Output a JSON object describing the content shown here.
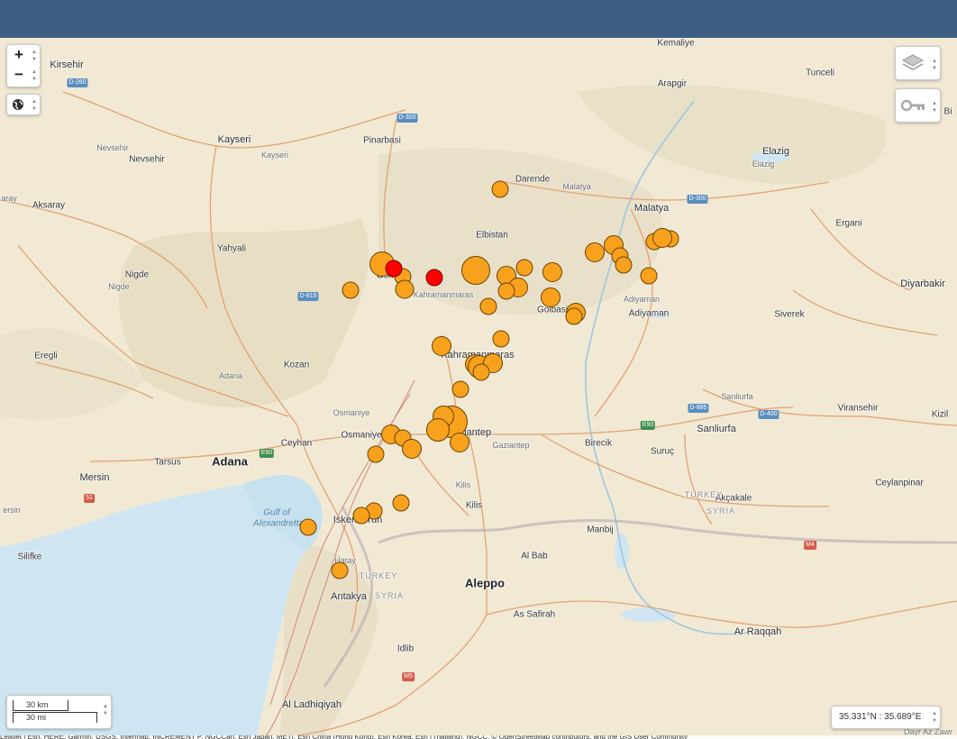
{
  "map": {
    "zoom": {
      "in_label": "+",
      "out_label": "−"
    },
    "coords": "35.331°N : 35.689°E",
    "scale": {
      "km": "30 km",
      "mi": "30 mi"
    },
    "attribution": "Leaflet | Esri, HERE, Garmin, USGS, Intermap, INCREMENT P, NGCCan, Esri Japan, METI, Esri China (Hong Kong), Esri Korea, Esri (Thailand), NGCC, © OpenStreetMap contributors, and the GIS User Community",
    "colors": {
      "quake": "#f7a11d",
      "recent_quake": "#ff0000",
      "header": "#3e5d82",
      "sea": "#cfe6f2"
    },
    "icons": [
      "layers-icon",
      "key-icon",
      "globe-icon"
    ],
    "labels": {
      "kirsehir": "Kirsehir",
      "kayseri": "Kayseri",
      "kayseri_small": "Kayseri",
      "nevsehir": "Nevsehir",
      "nevsehir_small": "Nevsehir",
      "aksaray": "Aksaray",
      "aray": "aray",
      "nigde": "Nigde",
      "nigde_small": "Nigde",
      "eregli": "Eregli",
      "yahyali": "Yahyali",
      "pinarbasi": "Pinarbasi",
      "kemaliye": "Kemaliye",
      "arapgir": "Arapgir",
      "tunceli": "Tunceli",
      "elazig": "Elazig",
      "elazig_small": "Elazig",
      "bi": "Bi",
      "darende": "Darende",
      "malatya_small": "Malatya",
      "malatya": "Malatya",
      "ergani": "Ergani",
      "elbistan": "Elbistan",
      "goksun": "Gök",
      "kahramanmaras_small": "Kahramanmaras",
      "golbasi": "Golbasi",
      "adiyaman_small": "Adiyaman",
      "adiyaman": "Adiyaman",
      "diyarbakir": "Diyarbakir",
      "siverek": "Siverek",
      "kahramanmaras": "Kahramanmaras",
      "kozan": "Kozan",
      "adana_small": "Adana",
      "adana": "Adana",
      "osmaniye_small": "Osmaniye",
      "osmaniye": "Osmaniye",
      "ceyhan": "Ceyhan",
      "tarsus": "Tarsus",
      "mersin": "Mersin",
      "ersin": "ersin",
      "silifke": "Silifke",
      "gaziantep": "Gaziantep",
      "gaziantep_small": "Gaziantep",
      "birecik": "Birecik",
      "suruc": "Suruç",
      "sanliurfa_small": "Sanliurfa",
      "sanliurfa": "Sanliurfa",
      "viransehir": "Viransehir",
      "kizil": "Kizil",
      "ceylanpinar": "Ceylanpinar",
      "akcakale": "Akçakale",
      "turkey": "TURKEY",
      "syria": "SYRIA",
      "turkey2": "TURKEY",
      "syria2": "SYRIA",
      "kilis_small": "Kilis",
      "kilis": "Kilis",
      "gulf1": "Gulf of",
      "gulf2": "Alexandretta",
      "iskenderun": "Iskenderun",
      "hatay": "Hatay",
      "antakya": "Antakya",
      "manbij": "Manbij",
      "albab": "Al Bab",
      "aleppo": "Aleppo",
      "assafirah": "As Safirah",
      "arraqqah": "Ar Raqqah",
      "idlib": "Idlib",
      "alladhiqiyah": "Al Ladhiqiyah",
      "dayraz": "Dayr Az Zawr"
    },
    "shields": {
      "d260": "D-260",
      "d300a": "D-300",
      "d300b": "D-300",
      "d815": "D-815",
      "d885": "D-885",
      "d400": "D-400",
      "e90a": "E90",
      "e90b": "E90",
      "s51": "51",
      "m4": "M4",
      "m5": "M5"
    }
  }
}
